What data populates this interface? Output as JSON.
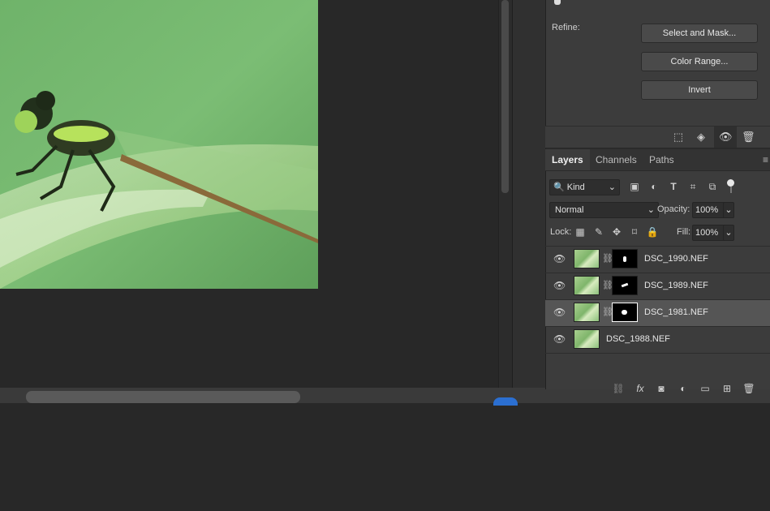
{
  "properties": {
    "refine_label": "Refine:",
    "select_and_mask": "Select and Mask...",
    "color_range": "Color Range...",
    "invert": "Invert"
  },
  "layers_panel": {
    "tabs": [
      "Layers",
      "Channels",
      "Paths"
    ],
    "active_tab": "Layers",
    "filter_kind": "Kind",
    "blend_mode": "Normal",
    "opacity_label": "Opacity:",
    "opacity_value": "100%",
    "lock_label": "Lock:",
    "fill_label": "Fill:",
    "fill_value": "100%",
    "layers": [
      {
        "name": "DSC_1990.NEF",
        "has_mask": true,
        "selected": false
      },
      {
        "name": "DSC_1989.NEF",
        "has_mask": true,
        "selected": false
      },
      {
        "name": "DSC_1981.NEF",
        "has_mask": true,
        "selected": true
      },
      {
        "name": "DSC_1988.NEF",
        "has_mask": false,
        "selected": false
      }
    ]
  },
  "icons": {
    "footer_props": [
      "marquee-icon",
      "mask-load-icon",
      "eye-icon",
      "trash-icon"
    ],
    "layers_bottom": [
      "link-icon",
      "fx-icon",
      "add-mask-icon",
      "adjustment-icon",
      "folder-icon",
      "new-layer-icon",
      "trash-icon"
    ]
  }
}
